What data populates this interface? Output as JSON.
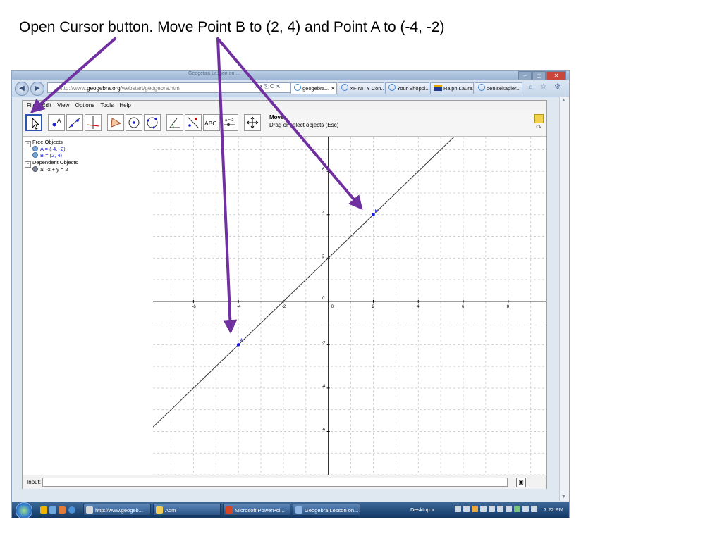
{
  "caption": "Open Cursor button.  Move Point B to (2, 4) and Point A to (-4, -2)",
  "browser": {
    "title": "Geogebra Lesson on ...",
    "url_prefix": "http://www.",
    "url_domain": "geogebra.org",
    "url_path": "/webstart/geogebra.html",
    "url_controls": "⌕ ▾ ⎘ C ✕",
    "tabs": [
      {
        "label": "geogebra...",
        "active": true
      },
      {
        "label": "XFINITY Con...",
        "active": false
      },
      {
        "label": "Your Shoppi...",
        "active": false
      },
      {
        "label": "Ralph Laure...",
        "active": false
      },
      {
        "label": "denisekapler...",
        "active": false
      }
    ],
    "tab_close": "✕",
    "window_buttons": [
      "–",
      "▢",
      "✕"
    ],
    "right_icons": "⌂ ☆ ⚙"
  },
  "geogebra": {
    "menu": [
      "File",
      "Edit",
      "View",
      "Options",
      "Tools",
      "Help"
    ],
    "tool_title": "Move",
    "tool_description": "Drag or select objects (Esc)",
    "text_tool_label": "ABC",
    "slider_tool_label": "a = 2",
    "algebra": {
      "free_objects_header": "Free Objects",
      "point_a": "A = (-4, -2)",
      "point_b": "B = (2, 4)",
      "dependent_objects_header": "Dependent Objects",
      "line_a": "a: -x + y = 2"
    },
    "input_label": "Input:",
    "input_value": "",
    "input_button": "▣"
  },
  "chart_data": {
    "type": "scatter",
    "x_ticks": [
      "-6",
      "-4",
      "-2",
      "0",
      "2",
      "4",
      "6",
      "8"
    ],
    "y_ticks": [
      "6",
      "4",
      "2",
      "0",
      "-2",
      "-4",
      "-6"
    ],
    "xlim": [
      -7.8,
      9.7
    ],
    "ylim": [
      -8,
      7.6
    ],
    "grid": true,
    "points": [
      {
        "label": "A",
        "x": -4,
        "y": -2
      },
      {
        "label": "B",
        "x": 2,
        "y": 4
      }
    ],
    "line": {
      "label": "a",
      "slope": 1,
      "intercept": 2
    },
    "point_color": "#1a1adc",
    "line_color": "#333333"
  },
  "taskbar": {
    "items": [
      "http://www.geogeb...",
      "Adm",
      "Microsoft PowerPoi...",
      "Geogebra Lesson on..."
    ],
    "desktop_label": "Desktop",
    "desktop_chevron": "»",
    "clock": "7:22 PM"
  },
  "colors": {
    "annotation_arrow": "#7030a0"
  }
}
